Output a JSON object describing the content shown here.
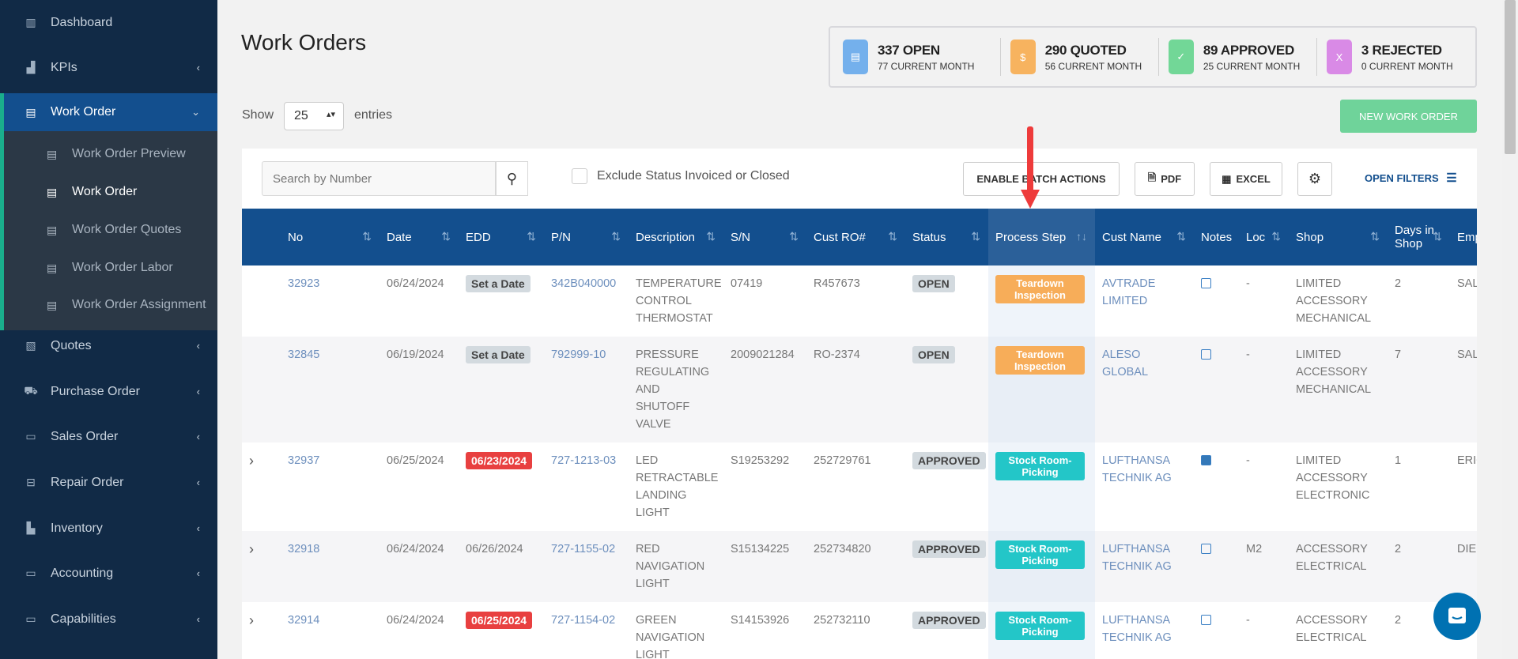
{
  "sidebar": {
    "items": [
      {
        "label": "Dashboard",
        "icon": "bar-chart-icon"
      },
      {
        "label": "KPIs",
        "icon": "kpi-chart-icon"
      },
      {
        "label": "Work Order",
        "icon": "server-icon"
      },
      {
        "label": "Quotes",
        "icon": "invoice-icon"
      },
      {
        "label": "Purchase Order",
        "icon": "cart-icon"
      },
      {
        "label": "Sales Order",
        "icon": "credit-card-icon"
      },
      {
        "label": "Repair Order",
        "icon": "toolbox-icon"
      },
      {
        "label": "Inventory",
        "icon": "warehouse-icon"
      },
      {
        "label": "Accounting",
        "icon": "money-icon"
      },
      {
        "label": "Capabilities",
        "icon": "archive-icon"
      }
    ],
    "submenu": [
      "Work Order Preview",
      "Work Order",
      "Work Order Quotes",
      "Work Order Labor",
      "Work Order Assignment"
    ]
  },
  "page": {
    "title": "Work Orders"
  },
  "stats": [
    {
      "main": "337 OPEN",
      "sub": "77 CURRENT MONTH",
      "color": "#74b0ec",
      "icon": "file-icon"
    },
    {
      "main": "290 QUOTED",
      "sub": "56 CURRENT MONTH",
      "color": "#f7b35f",
      "icon": "file-dollar-icon"
    },
    {
      "main": "89 APPROVED",
      "sub": "25 CURRENT MONTH",
      "color": "#72d797",
      "icon": "file-check-icon"
    },
    {
      "main": "3 REJECTED",
      "sub": "0 CURRENT MONTH",
      "color": "#d98ae6",
      "icon": "file-x-icon"
    }
  ],
  "length": {
    "show": "Show",
    "value": "25",
    "entries": "entries"
  },
  "new_button": "NEW WORK ORDER",
  "toolbar": {
    "search_placeholder": "Search by Number",
    "exclude_label": "Exclude Status Invoiced or Closed",
    "batch": "ENABLE BATCH ACTIONS",
    "pdf": "PDF",
    "excel": "EXCEL",
    "filters": "OPEN FILTERS"
  },
  "columns": [
    "No",
    "Date",
    "EDD",
    "P/N",
    "Description",
    "S/N",
    "Cust RO#",
    "Status",
    "Process Step",
    "Cust Name",
    "Notes",
    "Loc",
    "Shop",
    "Days in Shop",
    "Emp"
  ],
  "rows": [
    {
      "expand": false,
      "no": "32923",
      "date": "06/24/2024",
      "edd": "Set a Date",
      "edd_style": "gray",
      "pn": "342B040000",
      "desc": "TEMPERATURE CONTROL THERMOSTAT",
      "sn": "07419",
      "ro": "R457673",
      "status": "OPEN",
      "step": "Teardown Inspection",
      "step_style": "orange",
      "cust": "AVTRADE LIMITED",
      "note_filled": false,
      "loc": "-",
      "shop": "LIMITED ACCESSORY MECHANICAL",
      "days": "2",
      "emp": "SAL VAS"
    },
    {
      "expand": false,
      "no": "32845",
      "date": "06/19/2024",
      "edd": "Set a Date",
      "edd_style": "gray",
      "pn": "792999-10",
      "desc": "PRESSURE REGULATING AND SHUTOFF VALVE",
      "sn": "2009021284",
      "ro": "RO-2374",
      "status": "OPEN",
      "step": "Teardown Inspection",
      "step_style": "orange",
      "cust": "ALESO GLOBAL",
      "note_filled": false,
      "loc": "-",
      "shop": "LIMITED ACCESSORY MECHANICAL",
      "days": "7",
      "emp": "SAL VAS"
    },
    {
      "expand": true,
      "no": "32937",
      "date": "06/25/2024",
      "edd": "06/23/2024",
      "edd_style": "red",
      "pn": "727-1213-03",
      "desc": "LED RETRACTABLE LANDING LIGHT",
      "sn": "S19253292",
      "ro": "252729761",
      "status": "APPROVED",
      "step": "Stock Room-Picking",
      "step_style": "teal",
      "cust": "LUFTHANSA TECHNIK AG",
      "note_filled": true,
      "loc": "-",
      "shop": "LIMITED ACCESSORY ELECTRONIC",
      "days": "1",
      "emp": "ERIC"
    },
    {
      "expand": true,
      "no": "32918",
      "date": "06/24/2024",
      "edd": "06/26/2024",
      "edd_style": "plain",
      "pn": "727-1155-02",
      "desc": "RED NAVIGATION LIGHT",
      "sn": "S15134225",
      "ro": "252734820",
      "status": "APPROVED",
      "step": "Stock Room-Picking",
      "step_style": "teal",
      "cust": "LUFTHANSA TECHNIK AG",
      "note_filled": false,
      "loc": "M2",
      "shop": "ACCESSORY ELECTRICAL",
      "days": "2",
      "emp": "DIE SAL"
    },
    {
      "expand": true,
      "no": "32914",
      "date": "06/24/2024",
      "edd": "06/25/2024",
      "edd_style": "red",
      "pn": "727-1154-02",
      "desc": "GREEN NAVIGATION LIGHT",
      "sn": "S14153926",
      "ro": "252732110",
      "status": "APPROVED",
      "step": "Stock Room-Picking",
      "step_style": "teal",
      "cust": "LUFTHANSA TECHNIK AG",
      "note_filled": false,
      "loc": "-",
      "shop": "ACCESSORY ELECTRICAL",
      "days": "2",
      "emp": ""
    }
  ]
}
